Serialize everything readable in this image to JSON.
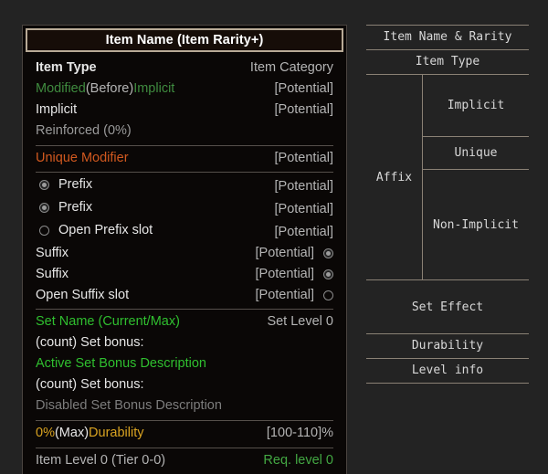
{
  "tooltip": {
    "title": "Item Name (Item Rarity+)",
    "type_row": {
      "left": "Item Type",
      "right": "Item Category"
    },
    "implicit_rows": [
      {
        "mod": "Modified",
        "before": "(Before)",
        "name": " Implicit",
        "right": "[Potential]"
      },
      {
        "mod": "",
        "before": "",
        "name": "Implicit",
        "right": "[Potential]"
      }
    ],
    "reinforced": "Reinforced (0%)",
    "unique_row": {
      "left": "Unique Modifier",
      "right": "[Potential]"
    },
    "prefix_rows": [
      {
        "label": "Prefix",
        "right": "[Potential]",
        "marker": "filled"
      },
      {
        "label": "Prefix",
        "right": "[Potential]",
        "marker": "filled"
      },
      {
        "label": "Open Prefix slot",
        "right": "[Potential]",
        "marker": "open"
      }
    ],
    "suffix_rows": [
      {
        "label": "Suffix",
        "right": "[Potential]",
        "marker": "filled"
      },
      {
        "label": "Suffix",
        "right": "[Potential]",
        "marker": "filled"
      },
      {
        "label": "Open Suffix slot",
        "right": "[Potential]",
        "marker": "open"
      }
    ],
    "set_row": {
      "left": "Set Name (Current/Max)",
      "right": "Set Level 0"
    },
    "set_bonus_count_1": "(count) Set bonus:",
    "set_bonus_active": "Active Set Bonus Description",
    "set_bonus_count_2": "(count) Set bonus:",
    "set_bonus_disabled": "Disabled Set Bonus Description",
    "durability_row": {
      "percent": "0%",
      "max": "(Max)",
      "label": " Durability",
      "right": "[100-110]%"
    },
    "level_row": {
      "left": "Item Level 0 (Tier 0-0)",
      "right": "Req. level 0"
    }
  },
  "panel": {
    "item_name_rarity": "Item Name & Rarity",
    "item_type": "Item Type",
    "affix": "Affix",
    "implicit": "Implicit",
    "unique": "Unique",
    "non_implicit": "Non-Implicit",
    "set_effect": "Set Effect",
    "durability": "Durability",
    "level_info": "Level info"
  },
  "colors": {
    "background": "#232323",
    "tooltip_bg": "#0a0706",
    "border": "#b8aa96",
    "green": "#2fbf2f",
    "dark_green": "#3f8b3f",
    "orange": "#d2591f",
    "gold": "#d9a321",
    "separator": "#56504b"
  }
}
